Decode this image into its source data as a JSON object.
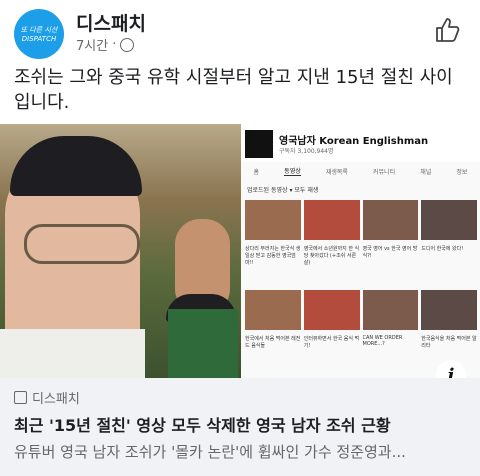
{
  "post": {
    "page_name": "디스패치",
    "avatar_text": "또 다른 시선 DISPATCH",
    "time": "7시간",
    "separator": "·",
    "text": "조쉬는 그와 중국 유학 시절부터 알고 지낸 15년 절친 사이입니다."
  },
  "youtube": {
    "channel_title": "영국남자 Korean Englishman",
    "subscribers": "구독자 3,100,944명",
    "tabs": [
      "홈",
      "동영상",
      "재생목록",
      "커뮤니티",
      "채널",
      "정보"
    ],
    "active_tab": "동영상",
    "sort_label": "업로드된 동영상 ▾   모두 재생",
    "row1_captions": [
      "상다리 부러지는 한국식 생일상 받고 감동한 영국엄마!!",
      "영국에서 소년원까지 한 식당 찾아갔다 (+조쉬 서른 살)",
      "영국 영어 vs 한국 영어 방식?!",
      "드디어 한국에 왔다!"
    ],
    "row2_captions": [
      "한국에서 처음 먹어본 레전드 음식들",
      "인터뷰하면서 한국 음식 먹기!",
      "CAN WE ORDER MORE...?",
      "한국음식을 처음 먹어본 알리타"
    ]
  },
  "link": {
    "source": "디스패치",
    "headline": "최근 '15년 절친' 영상 모두 삭제한 영국 남자 조쉬 근황",
    "description": "유튜버 영국 남자 조쉬가 '몰카 논란'에 휩싸인 가수 정준영과..."
  },
  "icons": {
    "like": "thumbs-up-icon",
    "globe": "globe-icon",
    "info": "info-icon"
  }
}
